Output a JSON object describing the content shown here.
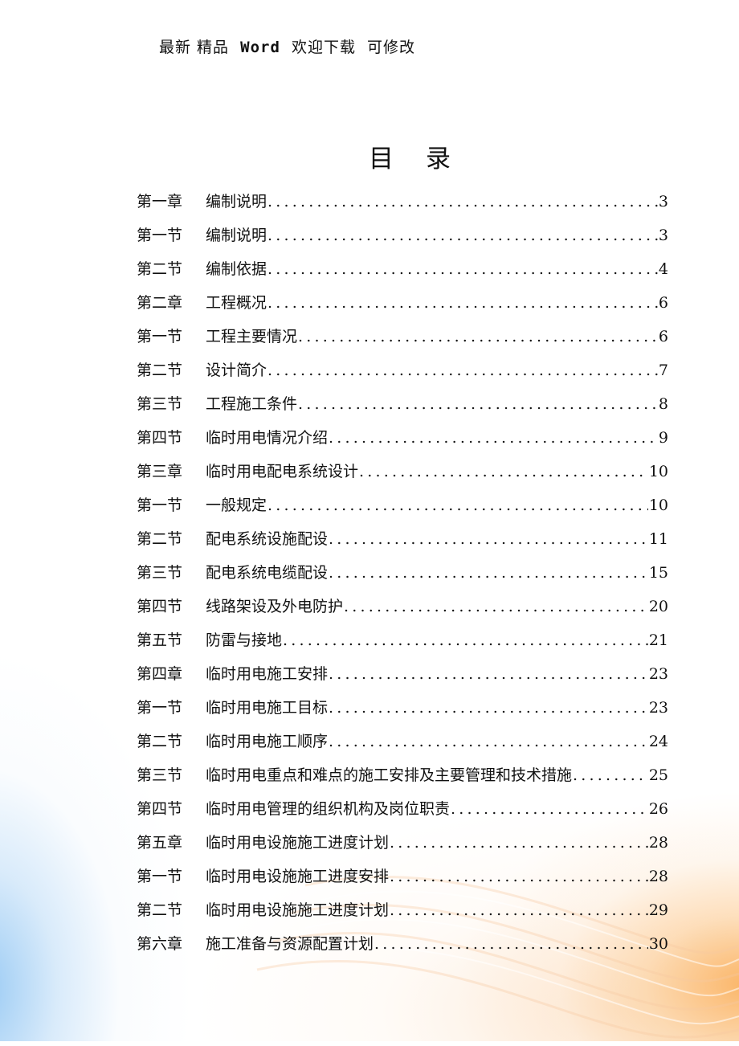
{
  "header": {
    "part1": "最新 精品  ",
    "word": "Word",
    "part2": "  欢迎下载  可修改"
  },
  "toc_title": "目录",
  "toc": [
    {
      "num": "第一章",
      "text": "编制说明",
      "page": "3",
      "level": "chapter"
    },
    {
      "num": "第一节",
      "text": "编制说明",
      "page": "3",
      "level": "section"
    },
    {
      "num": "第二节",
      "text": "编制依据",
      "page": "4",
      "level": "section"
    },
    {
      "num": "第二章",
      "text": "工程概况",
      "page": "6",
      "level": "chapter"
    },
    {
      "num": "第一节",
      "text": "工程主要情况",
      "page": "6",
      "level": "section"
    },
    {
      "num": "第二节",
      "text": "设计简介",
      "page": "7",
      "level": "section"
    },
    {
      "num": "第三节",
      "text": "工程施工条件",
      "page": "8",
      "level": "section"
    },
    {
      "num": "第四节",
      "text": "临时用电情况介绍",
      "page": "9",
      "level": "section"
    },
    {
      "num": "第三章",
      "text": "临时用电配电系统设计",
      "page": "10",
      "level": "chapter"
    },
    {
      "num": "第一节",
      "text": "一般规定",
      "page": "10",
      "level": "section"
    },
    {
      "num": "第二节",
      "text": "配电系统设施配设",
      "page": "11",
      "level": "section"
    },
    {
      "num": "第三节",
      "text": "配电系统电缆配设",
      "page": "15",
      "level": "section"
    },
    {
      "num": "第四节",
      "text": "线路架设及外电防护",
      "page": "20",
      "level": "section"
    },
    {
      "num": "第五节",
      "text": "防雷与接地",
      "page": "21",
      "level": "section"
    },
    {
      "num": "第四章",
      "text": "临时用电施工安排",
      "page": "23",
      "level": "chapter"
    },
    {
      "num": "第一节",
      "text": "临时用电施工目标",
      "page": "23",
      "level": "section"
    },
    {
      "num": "第二节",
      "text": "临时用电施工顺序",
      "page": "24",
      "level": "section"
    },
    {
      "num": "第三节",
      "text": "临时用电重点和难点的施工安排及主要管理和技术措施",
      "page": "25",
      "level": "section"
    },
    {
      "num": "第四节",
      "text": "临时用电管理的组织机构及岗位职责",
      "page": "26",
      "level": "section"
    },
    {
      "num": "第五章",
      "text": "临时用电设施施工进度计划",
      "page": "28",
      "level": "chapter"
    },
    {
      "num": "第一节",
      "text": "临时用电设施施工进度安排",
      "page": "28",
      "level": "section"
    },
    {
      "num": "第二节",
      "text": "临时用电设施施工进度计划",
      "page": "29",
      "level": "section"
    },
    {
      "num": "第六章",
      "text": "施工准备与资源配置计划",
      "page": "30",
      "level": "chapter"
    }
  ]
}
